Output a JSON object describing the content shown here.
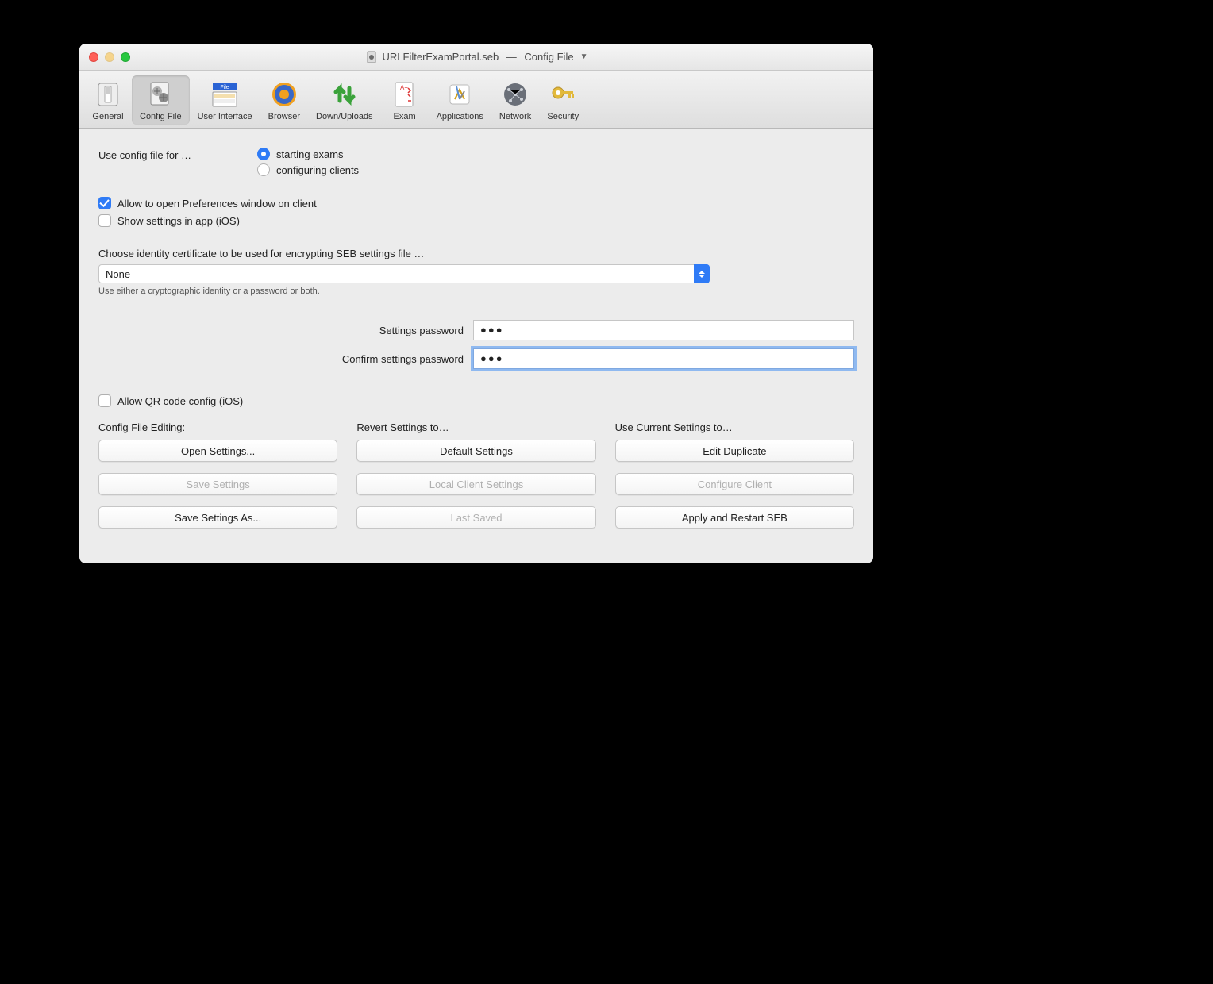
{
  "window": {
    "filename": "URLFilterExamPortal.seb",
    "panelname": "Config File"
  },
  "toolbar": {
    "tabs": [
      {
        "id": "general",
        "label": "General"
      },
      {
        "id": "configfile",
        "label": "Config File"
      },
      {
        "id": "ui",
        "label": "User Interface"
      },
      {
        "id": "browser",
        "label": "Browser"
      },
      {
        "id": "downup",
        "label": "Down/Uploads"
      },
      {
        "id": "exam",
        "label": "Exam"
      },
      {
        "id": "apps",
        "label": "Applications"
      },
      {
        "id": "network",
        "label": "Network"
      },
      {
        "id": "security",
        "label": "Security"
      }
    ],
    "active": "configfile"
  },
  "form": {
    "useConfigLabel": "Use config file for …",
    "radio": {
      "starting": "starting exams",
      "configuring": "configuring clients",
      "selected": "starting"
    },
    "allowPrefsLabel": "Allow to open Preferences window on client",
    "allowPrefsChecked": true,
    "showSettingsIosLabel": "Show settings in app (iOS)",
    "showSettingsIosChecked": false,
    "identityHeading": "Choose identity certificate to be used for encrypting SEB settings file …",
    "identityValue": "None",
    "identityHint": "Use either a cryptographic identity or a password or both.",
    "pwLabel": "Settings password",
    "pwConfirmLabel": "Confirm settings password",
    "pwValueMasked": "●●●",
    "pwConfirmValueMasked": "●●●",
    "allowQrLabel": "Allow QR code config (iOS)",
    "allowQrChecked": false
  },
  "groups": {
    "editing": {
      "head": "Config File Editing:",
      "open": "Open Settings...",
      "save": "Save Settings",
      "saveas": "Save Settings As..."
    },
    "revert": {
      "head": "Revert Settings to…",
      "default": "Default Settings",
      "local": "Local Client Settings",
      "last": "Last Saved"
    },
    "current": {
      "head": "Use Current Settings to…",
      "edit": "Edit Duplicate",
      "configure": "Configure Client",
      "apply": "Apply and Restart SEB"
    }
  }
}
